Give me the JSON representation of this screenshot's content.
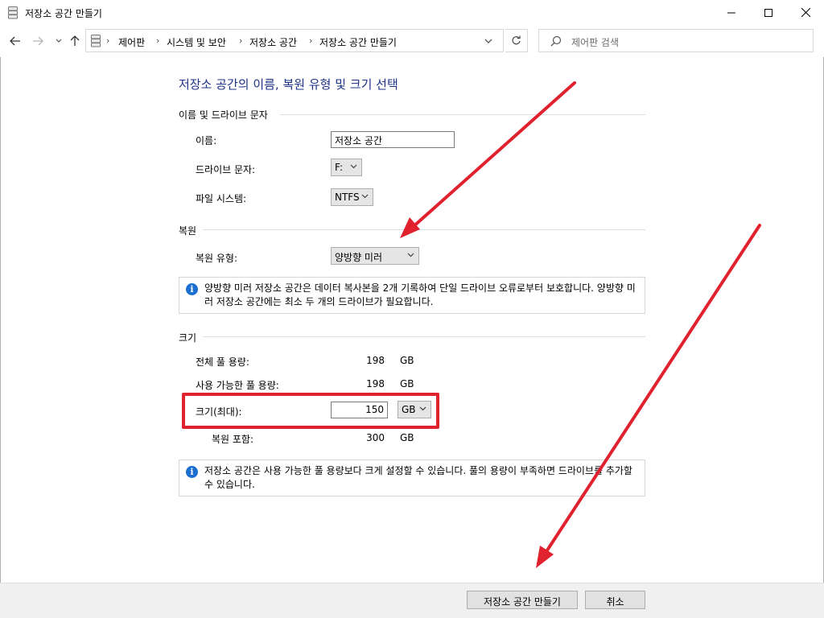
{
  "window": {
    "title": "저장소 공간 만들기"
  },
  "address": {
    "crumbs": [
      "제어판",
      "시스템 및 보안",
      "저장소 공간",
      "저장소 공간 만들기"
    ],
    "search_placeholder": "제어판 검색"
  },
  "content": {
    "heading": "저장소 공간의 이름, 복원 유형 및 크기 선택",
    "name_section": {
      "label": "이름 및 드라이브 문자",
      "name_label": "이름:",
      "name_value": "저장소 공간",
      "drive_label": "드라이브 문자:",
      "drive_value": "F:",
      "fs_label": "파일 시스템:",
      "fs_value": "NTFS"
    },
    "resiliency_section": {
      "label": "복원",
      "type_label": "복원 유형:",
      "type_value": "양방향 미러",
      "info": "양방향 미러 저장소 공간은 데이터 복사본을 2개 기록하여 단일 드라이브 오류로부터 보호합니다. 양방향 미러 저장소 공간에는 최소 두 개의 드라이브가 필요합니다."
    },
    "size_section": {
      "label": "크기",
      "total_label": "전체 풀 용량:",
      "total_value": "198",
      "total_unit": "GB",
      "available_label": "사용 가능한 풀 용량:",
      "available_value": "198",
      "available_unit": "GB",
      "size_label": "크기(최대):",
      "size_value": "150",
      "size_unit": "GB",
      "including_label": "복원 포함:",
      "including_value": "300",
      "including_unit": "GB",
      "info": "저장소 공간은 사용 가능한 풀 용량보다 크게 설정할 수 있습니다. 풀의 용량이 부족하면 드라이브를 추가할 수 있습니다."
    }
  },
  "buttons": {
    "create": "저장소 공간 만들기",
    "cancel": "취소"
  },
  "colors": {
    "heading": "#1e3287",
    "annotation": "#e0212e",
    "info_icon": "#1a6fd1"
  }
}
